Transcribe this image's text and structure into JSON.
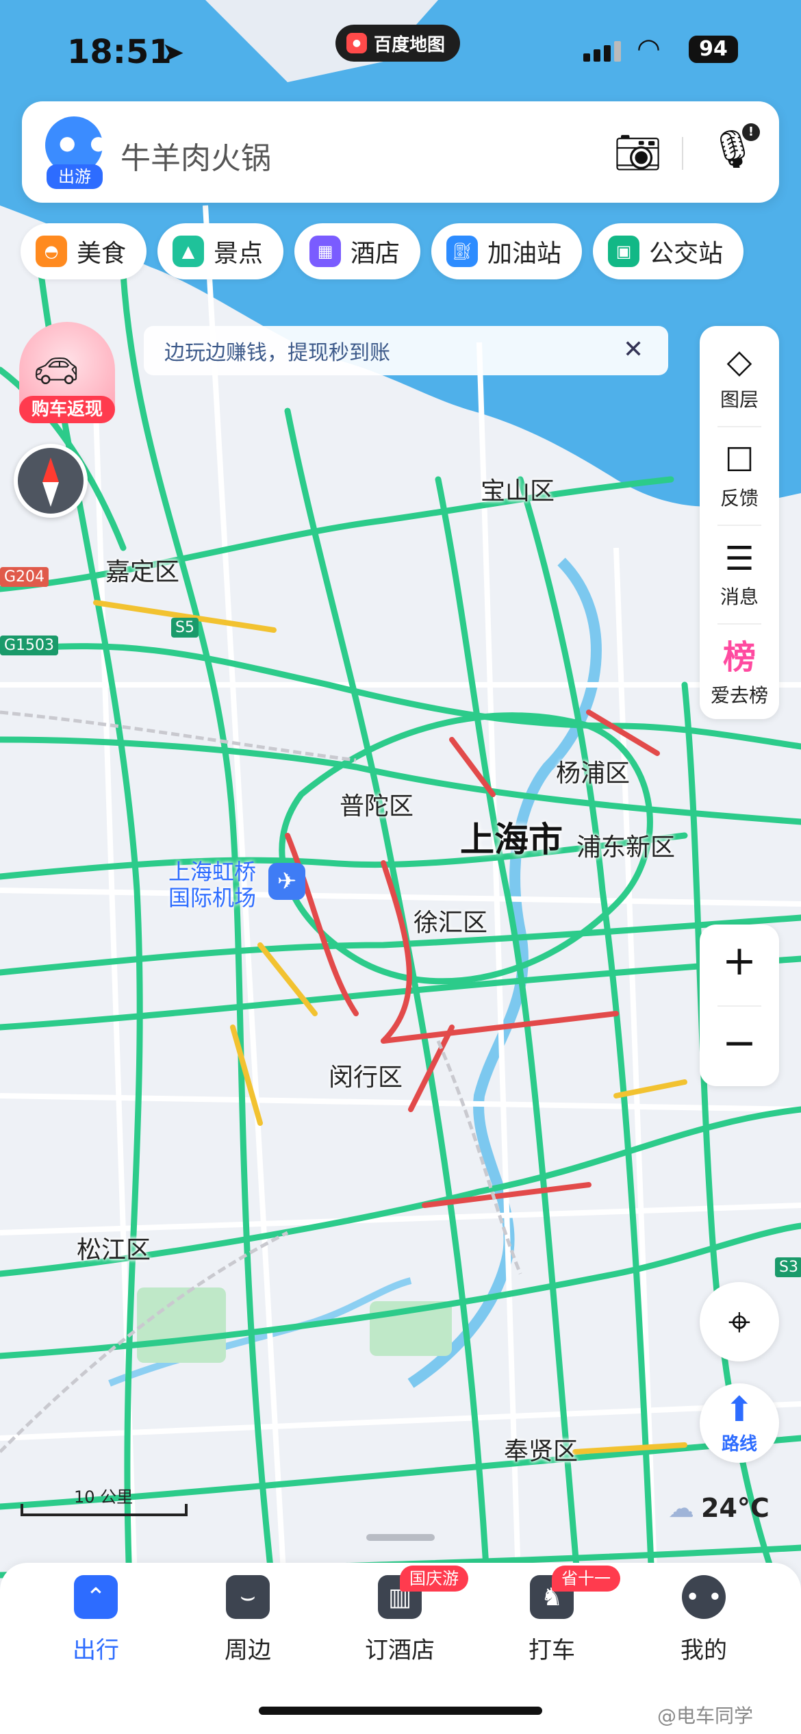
{
  "status_bar": {
    "time": "18:51",
    "app_name": "百度地图",
    "battery": "94"
  },
  "search": {
    "mascot_tag": "出游",
    "placeholder_text": "牛羊肉火锅"
  },
  "categories": [
    {
      "label": "美食",
      "icon": "food-icon",
      "color": "#ff8a1f"
    },
    {
      "label": "景点",
      "icon": "scenic-icon",
      "color": "#1fc29a"
    },
    {
      "label": "酒店",
      "icon": "hotel-icon",
      "color": "#7a5cff"
    },
    {
      "label": "加油站",
      "icon": "gas-station-icon",
      "color": "#2d8cff"
    },
    {
      "label": "公交站",
      "icon": "bus-stop-icon",
      "color": "#12b886"
    }
  ],
  "promo": {
    "label": "购车返现"
  },
  "banner": {
    "text": "边玩边赚钱，提现秒到账"
  },
  "toolbar": [
    {
      "label": "图层",
      "icon": "layers-icon"
    },
    {
      "label": "反馈",
      "icon": "feedback-icon"
    },
    {
      "label": "消息",
      "icon": "message-icon"
    },
    {
      "label": "爱去榜",
      "icon": "ranking-icon",
      "icon_text": "榜"
    }
  ],
  "map": {
    "places": {
      "baoshan": "宝山区",
      "jiading": "嘉定区",
      "putuo": "普陀区",
      "yangpu": "杨浦区",
      "shanghai": "上海市",
      "pudong": "浦东新区",
      "xuhui": "徐汇区",
      "minhang": "闵行区",
      "songjiang": "松江区",
      "fengxian": "奉贤区"
    },
    "airport_line1": "上海虹桥",
    "airport_line2": "国际机场",
    "shields": {
      "g204": "G204",
      "g1503": "G1503",
      "s5": "S5",
      "s3": "S3"
    },
    "scale_label": "10 公里",
    "weather": "24°C"
  },
  "zoom": {
    "plus": "+",
    "minus": "−"
  },
  "route_button": {
    "label": "路线"
  },
  "tabs": [
    {
      "label": "出行",
      "icon": "travel-icon",
      "active": true
    },
    {
      "label": "周边",
      "icon": "nearby-icon",
      "active": false
    },
    {
      "label": "订酒店",
      "icon": "book-hotel-icon",
      "active": false,
      "badge": "国庆游"
    },
    {
      "label": "打车",
      "icon": "taxi-icon",
      "active": false,
      "badge": "省十一"
    },
    {
      "label": "我的",
      "icon": "profile-icon",
      "active": false
    }
  ],
  "watermark": "@电车同学"
}
